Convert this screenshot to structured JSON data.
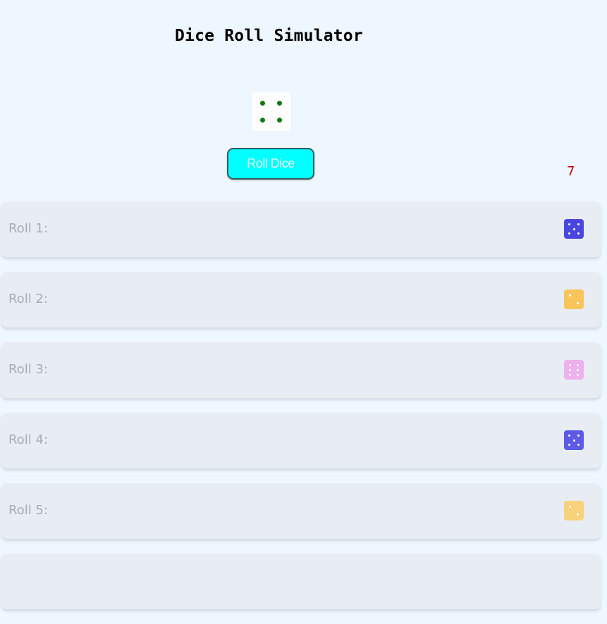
{
  "app": {
    "title": "Dice Roll Simulator"
  },
  "current_die": {
    "value": 4,
    "pip_color": "#137a12",
    "icon": "die-face-4-icon"
  },
  "roll_button": {
    "label": "Roll Dice",
    "background": "#00ffff"
  },
  "total": {
    "value": "7",
    "color": "#cc0000"
  },
  "history": [
    {
      "label": "Roll 1:",
      "value": 5,
      "color": "#4a47e0"
    },
    {
      "label": "Roll 2:",
      "value": 2,
      "color": "#f8c55a"
    },
    {
      "label": "Roll 3:",
      "value": 6,
      "color": "#eeb1ee"
    },
    {
      "label": "Roll 4:",
      "value": 5,
      "color": "#5d5ae6"
    },
    {
      "label": "Roll 5:",
      "value": 2,
      "color": "#f8d27a"
    },
    {
      "label": "",
      "value": null,
      "color": "#e8edf4"
    }
  ]
}
